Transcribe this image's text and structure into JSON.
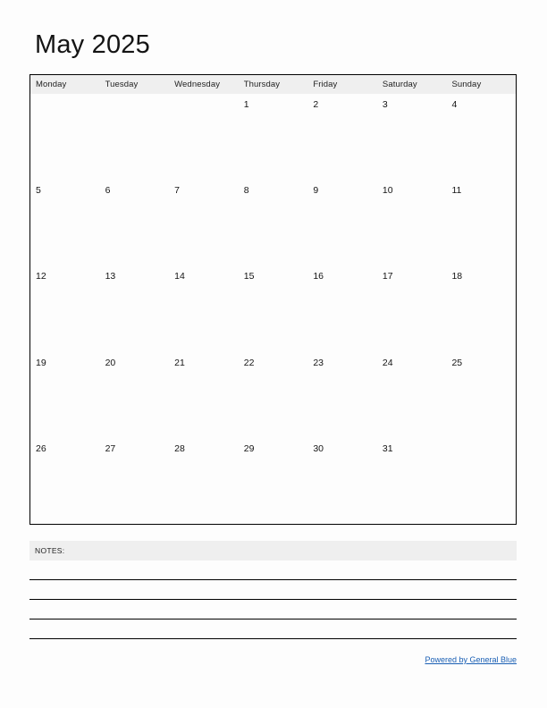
{
  "page": {
    "title": "May 2025",
    "background_color": "#fdfdfd",
    "border_color": "#000000",
    "header_band_color": "#efefef"
  },
  "calendar": {
    "month": "May",
    "year": "2025",
    "week_start": "Monday",
    "weekdays": [
      "Monday",
      "Tuesday",
      "Wednesday",
      "Thursday",
      "Friday",
      "Saturday",
      "Sunday"
    ],
    "weeks": [
      [
        "",
        "",
        "",
        "1",
        "2",
        "3",
        "4"
      ],
      [
        "5",
        "6",
        "7",
        "8",
        "9",
        "10",
        "11"
      ],
      [
        "12",
        "13",
        "14",
        "15",
        "16",
        "17",
        "18"
      ],
      [
        "19",
        "20",
        "21",
        "22",
        "23",
        "24",
        "25"
      ],
      [
        "26",
        "27",
        "28",
        "29",
        "30",
        "31",
        ""
      ]
    ]
  },
  "notes": {
    "label": "NOTES:",
    "line_count": 4
  },
  "footer": {
    "link_text": "Powered by General Blue",
    "link_color": "#1a5fb4"
  }
}
